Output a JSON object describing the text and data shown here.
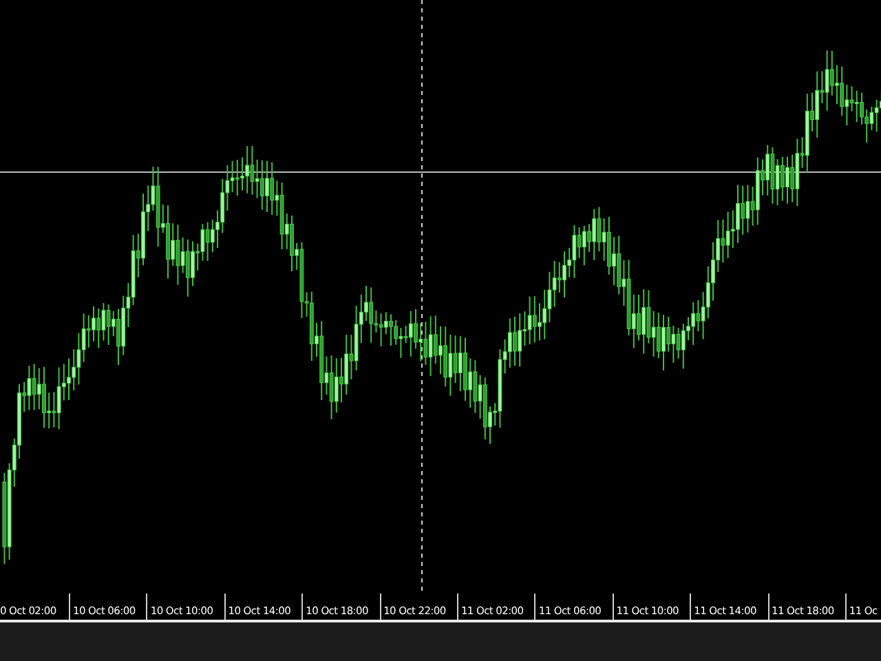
{
  "chart": {
    "time_axis_labels": [
      "0 Oct 02:00",
      "10 Oct 06:00",
      "10 Oct 10:00",
      "10 Oct 14:00",
      "10 Oct 18:00",
      "10 Oct 22:00",
      "11 Oct 02:00",
      "11 Oct 06:00",
      "11 Oct 10:00",
      "11 Oct 14:00",
      "11 Oct 18:00",
      "11 Oc"
    ]
  }
}
